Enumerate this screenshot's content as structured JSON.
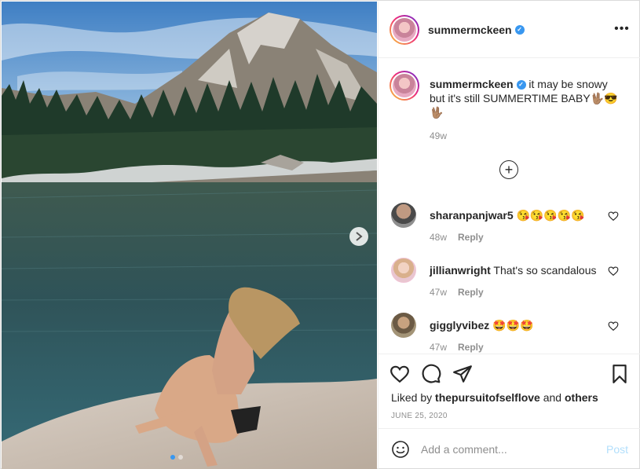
{
  "post": {
    "author": "summermckeen",
    "verified": true,
    "more_icon": "more-horizontal-icon",
    "more_label": "•••",
    "carousel": {
      "current_slide": 1,
      "total_slides": 2
    }
  },
  "caption": {
    "username": "summermckeen",
    "text": "it may be snowy but it's still SUMMERTIME BABY🖖🏽😎🖖🏽",
    "time": "49w"
  },
  "load_more_label": "+",
  "comments": [
    {
      "username": "sharanpanjwar5",
      "text": "😘😘😘😘😘",
      "time": "48w",
      "reply": "Reply"
    },
    {
      "username": "jillianwright",
      "text": "That's so scandalous",
      "time": "47w",
      "reply": "Reply"
    },
    {
      "username": "gigglyvibez",
      "text": "🤩🤩🤩",
      "time": "47w",
      "reply": "Reply"
    }
  ],
  "actions": {
    "like_icon": "heart-icon",
    "comment_icon": "comment-icon",
    "share_icon": "paper-plane-icon",
    "save_icon": "bookmark-icon"
  },
  "likes": {
    "prefix": "Liked by",
    "user": "thepursuitofselflove",
    "joiner": "and",
    "suffix": "others"
  },
  "date": "JUNE 25, 2020",
  "add_comment": {
    "placeholder": "Add a comment...",
    "post_label": "Post",
    "emoji_icon": "smiley-icon"
  },
  "colors": {
    "accent": "#3897f0",
    "muted": "#8e8e8e",
    "post_disabled": "#b2dffc"
  }
}
